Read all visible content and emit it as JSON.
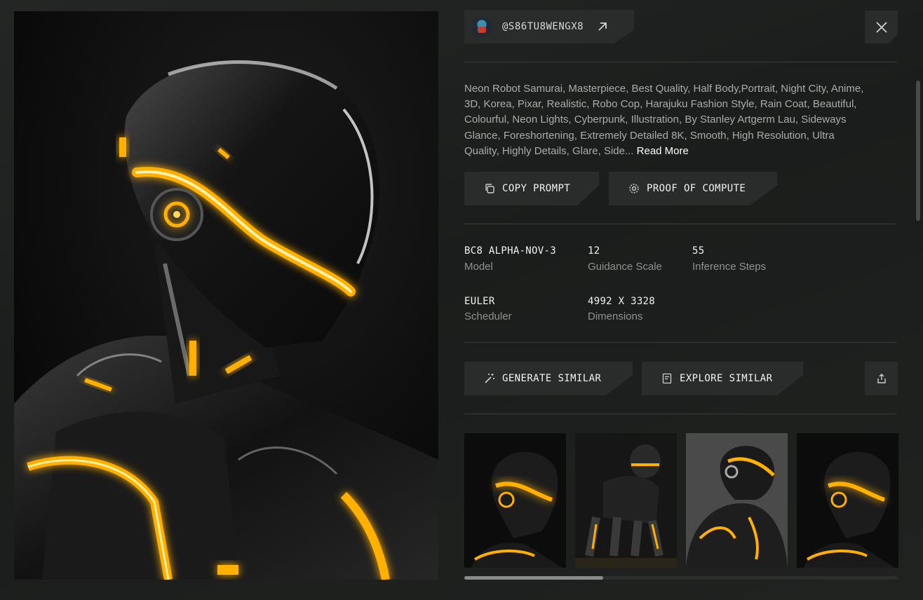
{
  "user": {
    "handle": "@S86TU8WENGX8"
  },
  "prompt": {
    "text": "Neon Robot Samurai, Masterpiece, Best Quality, Half Body,Portrait, Night City, Anime, 3D, Korea, Pixar, Realistic, Robo Cop, Harajuku Fashion Style, Rain Coat, Beautiful, Colourful, Neon Lights, Cyberpunk, Illustration, By Stanley Artgerm Lau, Sideways Glance, Foreshortening, Extremely Detailed 8K, Smooth, High Resolution, Ultra Quality, Highly Details, Glare, Side...",
    "read_more": "Read More"
  },
  "actions": {
    "copy_prompt": "COPY PROMPT",
    "proof_of_compute": "PROOF OF COMPUTE",
    "generate_similar": "GENERATE SIMILAR",
    "explore_similar": "EXPLORE SIMILAR"
  },
  "meta": {
    "model": {
      "value": "BC8 ALPHA-NOV-3",
      "label": "Model"
    },
    "guidance": {
      "value": "12",
      "label": "Guidance Scale"
    },
    "steps": {
      "value": "55",
      "label": "Inference Steps"
    },
    "scheduler": {
      "value": "EULER",
      "label": "Scheduler"
    },
    "dimensions": {
      "value": "4992 X 3328",
      "label": "Dimensions"
    }
  },
  "icons": {
    "external_link": "arrow-up-right-icon",
    "close": "close-icon",
    "copy": "copy-icon",
    "proof": "gear-icon",
    "generate": "magic-wand-icon",
    "explore": "document-icon",
    "share": "share-icon"
  },
  "colors": {
    "accent_glow": "#ffb000",
    "panel": "#2a2c2b",
    "muted_text": "#a9acaa"
  },
  "gallery": {
    "visible_thumbnails": 4,
    "horizontal_scroll_fraction": 0.32
  }
}
